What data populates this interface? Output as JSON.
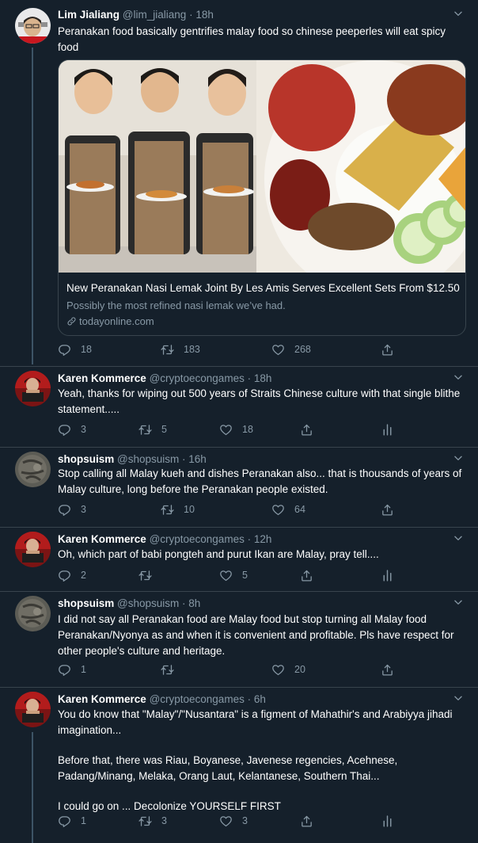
{
  "tweets": [
    {
      "name": "Lim Jialiang",
      "handle": "@lim_jialiang",
      "time": "18h",
      "text": "Peranakan food basically gentrifies malay food so chinese peeperles will eat spicy food",
      "card": {
        "title": "New Peranakan Nasi Lemak Joint By Les Amis Serves Excellent Sets From $12.50",
        "description": "Possibly the most refined nasi lemak we’ve had.",
        "domain": "todayonline.com"
      },
      "replies": "18",
      "retweets": "183",
      "likes": "268"
    },
    {
      "name": "Karen Kommerce",
      "handle": "@cryptoecongames",
      "time": "18h",
      "text": "Yeah, thanks for wiping out 500 years of Straits Chinese culture with that single blithe statement.....",
      "replies": "3",
      "retweets": "5",
      "likes": "18"
    },
    {
      "name": "shopsuism",
      "handle": "@shopsuism",
      "time": "16h",
      "text": "Stop calling all Malay kueh and dishes Peranakan also... that is thousands of years of Malay culture, long before the Peranakan people existed.",
      "replies": "3",
      "retweets": "10",
      "likes": "64"
    },
    {
      "name": "Karen Kommerce",
      "handle": "@cryptoecongames",
      "time": "12h",
      "text": "Oh, which part of babi pongteh and purut Ikan are Malay, pray tell....",
      "replies": "2",
      "retweets": "",
      "likes": "5"
    },
    {
      "name": "shopsuism",
      "handle": "@shopsuism",
      "time": "8h",
      "text": "I did not say all Peranakan food are Malay food but stop turning all Malay food Peranakan/Nyonya as and when it is convenient and profitable. Pls have respect for other people's culture and heritage.",
      "replies": "1",
      "retweets": "",
      "likes": "20"
    },
    {
      "name": "Karen Kommerce",
      "handle": "@cryptoecongames",
      "time": "6h",
      "text_lines": [
        "You do know that \"Malay\"/\"Nusantara\" is a figment of Mahathir's and Arabiyya jihadi  imagination...",
        "Before that, there was Riau, Boyanese, Javenese regencies, Acehnese, Padang/Minang, Melaka, Orang Laut, Kelantanese, Southern Thai...",
        "I could go on ... Decolonize YOURSELF FIRST"
      ],
      "replies": "1",
      "retweets": "3",
      "likes": "3"
    }
  ],
  "icons": [
    "reply-icon",
    "retweet-icon",
    "like-icon",
    "share-icon",
    "analytics-icon",
    "caret-down-icon",
    "link-icon"
  ],
  "colors": {
    "background": "#15202b",
    "muted": "#8899a6",
    "border": "#38444d",
    "thread": "#3d5466"
  }
}
